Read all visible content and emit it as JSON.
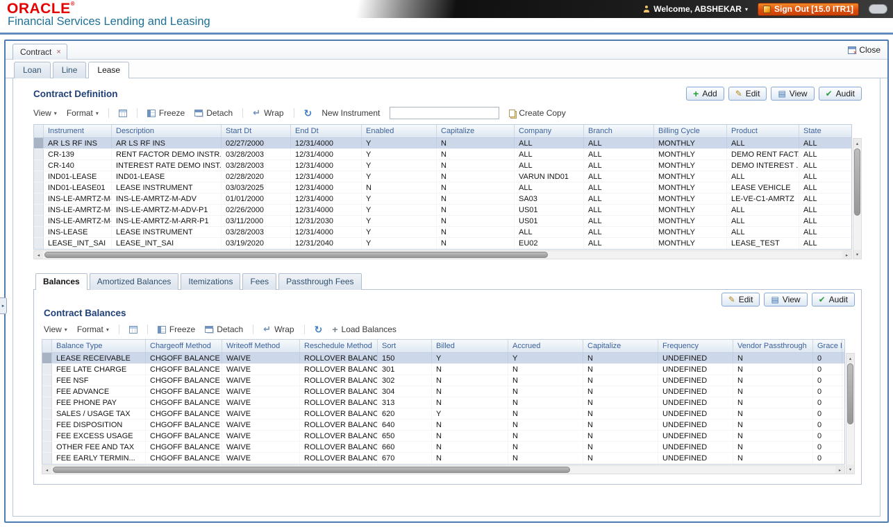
{
  "colors": {
    "oracle_red": "#e60000",
    "app_title_teal": "#1d7096",
    "signout_orange": "#dd4d0c",
    "heading_navy": "#1f3f77",
    "column_header_blue": "#3c619b",
    "selected_row_blue": "#ccd8ea",
    "frame_border_blue": "#4f7cb0"
  },
  "icons": {
    "caret_down": "▾",
    "scroll_left": "◂",
    "scroll_right": "▸",
    "scroll_up": "▴",
    "scroll_down": "▾",
    "collapse_arrow": "▸",
    "pencil": "✎",
    "check": "✔",
    "grid": "▤",
    "refresh": "↻",
    "wrap_arrow": "↵",
    "plus": "+",
    "tab_close": "×"
  },
  "header": {
    "brand": "ORACLE",
    "reg": "®",
    "app_title": "Financial Services Lending and Leasing",
    "welcome": "Welcome, ABSHEKAR",
    "sign_out": "Sign Out [15.0 ITR1]"
  },
  "window": {
    "tab_label": "Contract",
    "close_label": "Close"
  },
  "product_tabs": [
    {
      "label": "Loan"
    },
    {
      "label": "Line"
    },
    {
      "label": "Lease"
    }
  ],
  "contract_definition": {
    "title": "Contract Definition",
    "buttons": {
      "add": "Add",
      "edit": "Edit",
      "view": "View",
      "audit": "Audit"
    },
    "toolbar": {
      "view": "View",
      "format": "Format",
      "freeze": "Freeze",
      "detach": "Detach",
      "wrap": "Wrap",
      "new_instrument_label": "New Instrument",
      "new_instrument_value": "",
      "create_copy": "Create Copy"
    },
    "columns": [
      "Instrument",
      "Description",
      "Start Dt",
      "End Dt",
      "Enabled",
      "Capitalize",
      "Company",
      "Branch",
      "Billing Cycle",
      "Product",
      "State"
    ],
    "rows": [
      [
        "AR LS RF INS",
        "AR LS RF INS",
        "02/27/2000",
        "12/31/4000",
        "Y",
        "N",
        "ALL",
        "ALL",
        "MONTHLY",
        "ALL",
        "ALL"
      ],
      [
        "CR-139",
        "RENT FACTOR DEMO INSTR...",
        "03/28/2003",
        "12/31/4000",
        "Y",
        "N",
        "ALL",
        "ALL",
        "MONTHLY",
        "DEMO RENT FACT...",
        "ALL"
      ],
      [
        "CR-140",
        "INTEREST RATE DEMO INST...",
        "03/28/2003",
        "12/31/4000",
        "Y",
        "N",
        "ALL",
        "ALL",
        "MONTHLY",
        "DEMO INTEREST ...",
        "ALL"
      ],
      [
        "IND01-LEASE",
        "IND01-LEASE",
        "02/28/2020",
        "12/31/4000",
        "Y",
        "N",
        "VARUN IND01",
        "ALL",
        "MONTHLY",
        "ALL",
        "ALL"
      ],
      [
        "IND01-LEASE01",
        "LEASE INSTRUMENT",
        "03/03/2025",
        "12/31/4000",
        "N",
        "N",
        "ALL",
        "ALL",
        "MONTHLY",
        "LEASE VEHICLE",
        "ALL"
      ],
      [
        "INS-LE-AMRTZ-M-...",
        "INS-LE-AMRTZ-M-ADV",
        "01/01/2000",
        "12/31/4000",
        "Y",
        "N",
        "SA03",
        "ALL",
        "MONTHLY",
        "LE-VE-C1-AMRTZ",
        "ALL"
      ],
      [
        "INS-LE-AMRTZ-M-...",
        "INS-LE-AMRTZ-M-ADV-P1",
        "02/26/2000",
        "12/31/4000",
        "Y",
        "N",
        "US01",
        "ALL",
        "MONTHLY",
        "ALL",
        "ALL"
      ],
      [
        "INS-LE-AMRTZ-M-...",
        "INS-LE-AMRTZ-M-ARR-P1",
        "03/11/2000",
        "12/31/2030",
        "Y",
        "N",
        "US01",
        "ALL",
        "MONTHLY",
        "ALL",
        "ALL"
      ],
      [
        "INS-LEASE",
        "LEASE INSTRUMENT",
        "03/28/2003",
        "12/31/4000",
        "Y",
        "N",
        "ALL",
        "ALL",
        "MONTHLY",
        "ALL",
        "ALL"
      ],
      [
        "LEASE_INT_SAI",
        "LEASE_INT_SAI",
        "03/19/2020",
        "12/31/2040",
        "Y",
        "N",
        "EU02",
        "ALL",
        "MONTHLY",
        "LEASE_TEST",
        "ALL"
      ]
    ],
    "selected_row": 0
  },
  "balance_tabs": [
    "Balances",
    "Amortized Balances",
    "Itemizations",
    "Fees",
    "Passthrough Fees"
  ],
  "contract_balances": {
    "title": "Contract Balances",
    "buttons": {
      "edit": "Edit",
      "view": "View",
      "audit": "Audit"
    },
    "toolbar": {
      "view": "View",
      "format": "Format",
      "freeze": "Freeze",
      "detach": "Detach",
      "wrap": "Wrap",
      "load_balances": "Load Balances"
    },
    "columns": [
      "Balance Type",
      "Chargeoff Method",
      "Writeoff Method",
      "Reschedule Method",
      "Sort",
      "Billed",
      "Accrued",
      "Capitalize",
      "Frequency",
      "Vendor Passthrough",
      "Grace Da..."
    ],
    "rows": [
      [
        "LEASE RECEIVABLE",
        "CHGOFF BALANCE",
        "WAIVE",
        "ROLLOVER BALANCE",
        "150",
        "Y",
        "Y",
        "N",
        "UNDEFINED",
        "N",
        "0"
      ],
      [
        "FEE LATE CHARGE",
        "CHGOFF BALANCE",
        "WAIVE",
        "ROLLOVER BALANCE",
        "301",
        "N",
        "N",
        "N",
        "UNDEFINED",
        "N",
        "0"
      ],
      [
        "FEE NSF",
        "CHGOFF BALANCE",
        "WAIVE",
        "ROLLOVER BALANCE",
        "302",
        "N",
        "N",
        "N",
        "UNDEFINED",
        "N",
        "0"
      ],
      [
        "FEE ADVANCE",
        "CHGOFF BALANCE",
        "WAIVE",
        "ROLLOVER BALANCE",
        "304",
        "N",
        "N",
        "N",
        "UNDEFINED",
        "N",
        "0"
      ],
      [
        "FEE PHONE PAY",
        "CHGOFF BALANCE",
        "WAIVE",
        "ROLLOVER BALANCE",
        "313",
        "N",
        "N",
        "N",
        "UNDEFINED",
        "N",
        "0"
      ],
      [
        "SALES / USAGE TAX",
        "CHGOFF BALANCE",
        "WAIVE",
        "ROLLOVER BALANCE",
        "620",
        "Y",
        "N",
        "N",
        "UNDEFINED",
        "N",
        "0"
      ],
      [
        "FEE DISPOSITION",
        "CHGOFF BALANCE",
        "WAIVE",
        "ROLLOVER BALANCE",
        "640",
        "N",
        "N",
        "N",
        "UNDEFINED",
        "N",
        "0"
      ],
      [
        "FEE EXCESS USAGE",
        "CHGOFF BALANCE",
        "WAIVE",
        "ROLLOVER BALANCE",
        "650",
        "N",
        "N",
        "N",
        "UNDEFINED",
        "N",
        "0"
      ],
      [
        "OTHER FEE AND TAX",
        "CHGOFF BALANCE",
        "WAIVE",
        "ROLLOVER BALANCE",
        "660",
        "N",
        "N",
        "N",
        "UNDEFINED",
        "N",
        "0"
      ],
      [
        "FEE EARLY TERMIN...",
        "CHGOFF BALANCE",
        "WAIVE",
        "ROLLOVER BALANCE",
        "670",
        "N",
        "N",
        "N",
        "UNDEFINED",
        "N",
        "0"
      ]
    ],
    "selected_row": 0
  }
}
